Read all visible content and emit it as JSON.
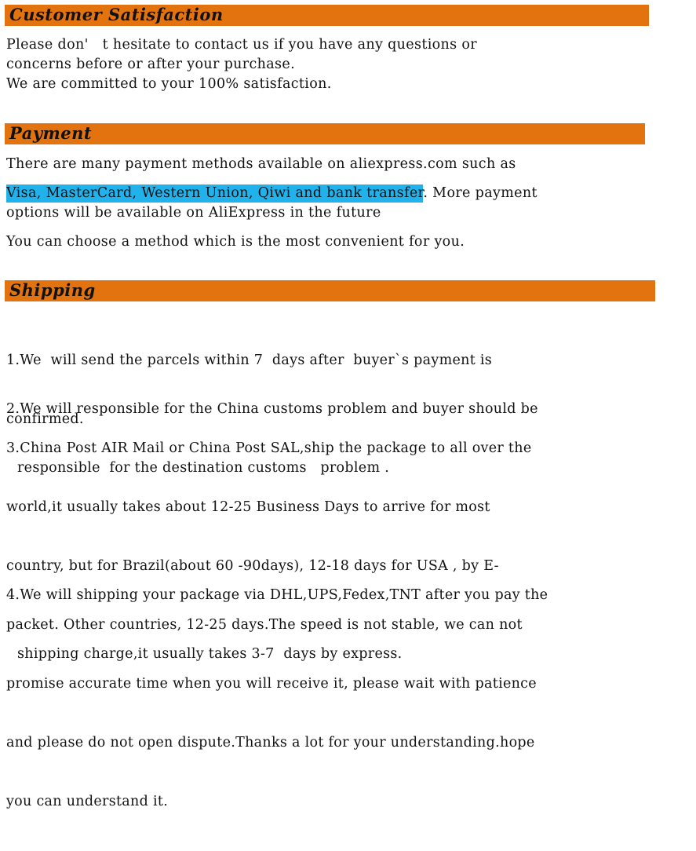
{
  "document": {
    "type": "product-policy-description",
    "accent_color": "#E3730F",
    "highlight_color": "#21B2EC",
    "text_color": "#121212",
    "background_color": "#FFFFFF"
  },
  "sections": {
    "satisfaction": {
      "heading": "Customer Satisfaction",
      "paragraphs": [
        "Please don'　t hesitate to contact us if you have any questions or\nconcerns before or after your purchase.",
        "We are committed to your 100% satisfaction."
      ]
    },
    "payment": {
      "heading": "Payment",
      "intro": "There are many payment methods available on aliexpress.com such as",
      "highlighted_methods": "Visa, MasterCard, Western Union, Qiwi and bank transfer",
      "after_highlight": ". More payment\noptions will be available on AliExpress in the future",
      "closing": "You can choose a method which is the most convenient for you."
    },
    "shipping": {
      "heading": "Shipping",
      "items": [
        {
          "number": "1.",
          "line1": "We  will send the parcels within 7  days after  buyer`s payment is",
          "line2": "confirmed."
        },
        {
          "number": "2.",
          "line1": "We will responsible for the China customs problem and buyer should be",
          "line2": "responsible  for the destination customs   problem ."
        },
        {
          "number": "3.",
          "line1": "China Post AIR Mail or China Post SAL,ship the package to all over the",
          "line2": "world,it usually takes about 12-25 Business Days to arrive for most",
          "line3": "country, but for Brazil(about 60 -90days), 12-18 days for USA , by E-",
          "line4": "packet. Other countries, 12-25 days.The speed is not stable, we can not",
          "line5": "promise accurate time when you will receive it, please wait with patience",
          "line6": "and please do not open dispute.Thanks a lot for your understanding.hope",
          "line7": "you can understand it."
        },
        {
          "number": "4.",
          "line1": "We will shipping your package via DHL,UPS,Fedex,TNT after you pay the",
          "line2": "shipping charge,it usually takes 3-7  days by express."
        }
      ]
    }
  }
}
